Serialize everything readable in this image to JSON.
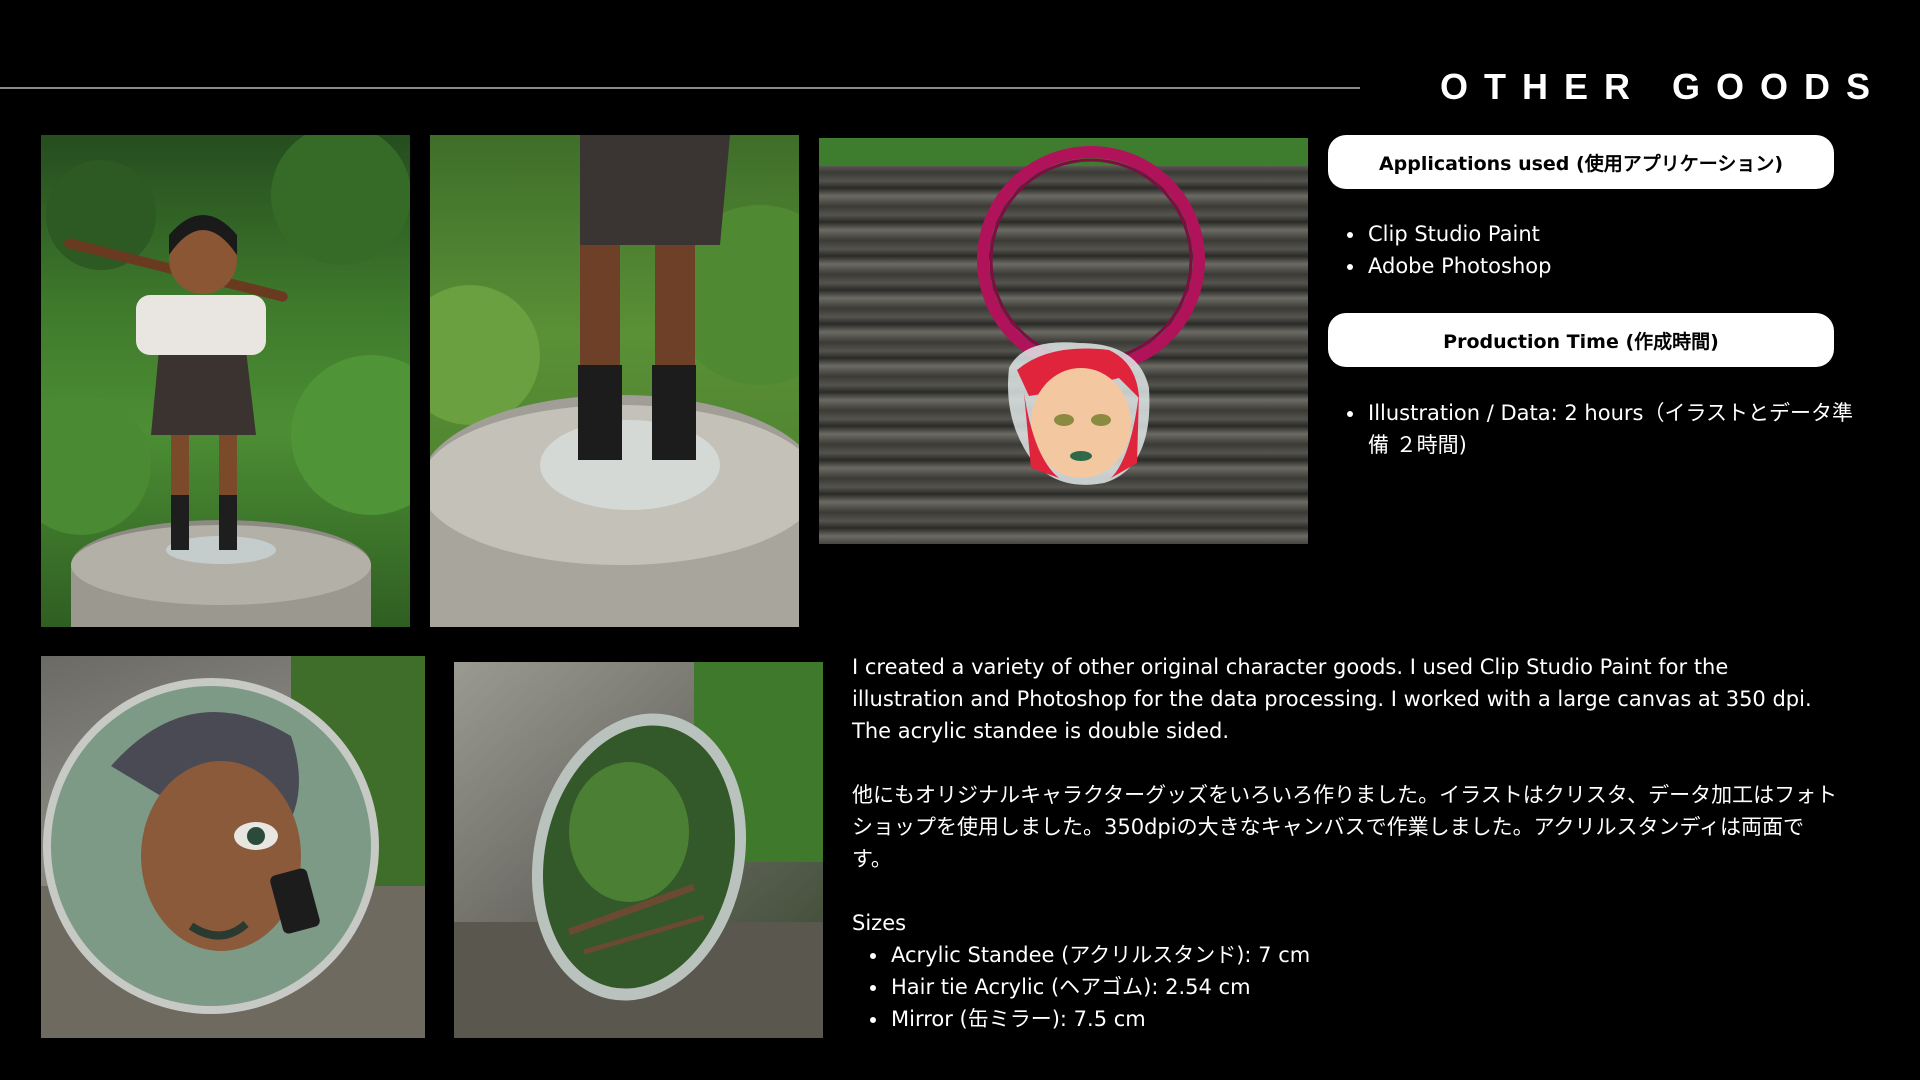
{
  "header": {
    "title": "OTHER GOODS"
  },
  "photos": {
    "standee_full": "acrylic-standee-photo",
    "standee_closeup": "standee-base-photo",
    "hair_tie": "hair-tie-photo",
    "badge": "badge-photo",
    "mirror": "mirror-photo"
  },
  "applications": {
    "heading": "Applications used (使用アプリケーション)",
    "items": [
      "Clip Studio Paint",
      "Adobe Photoshop"
    ]
  },
  "production": {
    "heading": "Production Time (作成時間)",
    "items": [
      "Illustration / Data: 2 hours（イラストとデータ準備 ２時間)"
    ]
  },
  "description": {
    "english": "I created a variety of other original character goods. I used Clip Studio Paint for the illustration and Photoshop for the data processing. I worked with a large canvas at 350 dpi. The acrylic standee is double sided.",
    "japanese": "他にもオリジナルキャラクターグッズをいろいろ作りました。イラストはクリスタ、データ加工はフォトショップを使用しました。350dpiの大きなキャンバスで作業しました。アクリルスタンディは両面です。"
  },
  "sizes": {
    "label": "Sizes",
    "items": [
      "Acrylic Standee (アクリルスタンド): 7 cm",
      "Hair tie Acrylic (ヘアゴム): 2.54 cm",
      "Mirror (缶ミラー):  7.5 cm"
    ]
  },
  "colors": {
    "background": "#000000",
    "text": "#ffffff",
    "pill_bg": "#ffffff",
    "pill_text": "#000000",
    "rule": "#8a8a8a",
    "hair_tie": "#b0135a"
  }
}
